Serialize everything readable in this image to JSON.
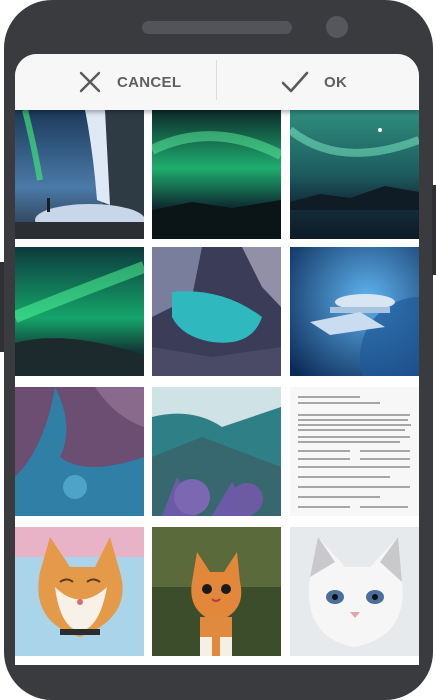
{
  "toolbar": {
    "cancel_label": "CANCEL",
    "ok_label": "OK",
    "cancel_icon": "close-icon",
    "ok_icon": "check-icon"
  },
  "colors": {
    "device_body": "#3a3b3f",
    "toolbar_bg": "#f7f7f7",
    "toolbar_text": "#5f5f5f"
  },
  "images": [
    {
      "name": "image-aurora-waterfall"
    },
    {
      "name": "image-aurora-green-sky"
    },
    {
      "name": "image-aurora-teal-lake"
    },
    {
      "name": "image-aurora-hill"
    },
    {
      "name": "image-satellite-coast"
    },
    {
      "name": "image-spaceship"
    },
    {
      "name": "image-satellite-delta"
    },
    {
      "name": "image-misty-valley"
    },
    {
      "name": "image-document-scan"
    },
    {
      "name": "image-cat-smiling"
    },
    {
      "name": "image-kitten-walking"
    },
    {
      "name": "image-kitten-white"
    }
  ]
}
